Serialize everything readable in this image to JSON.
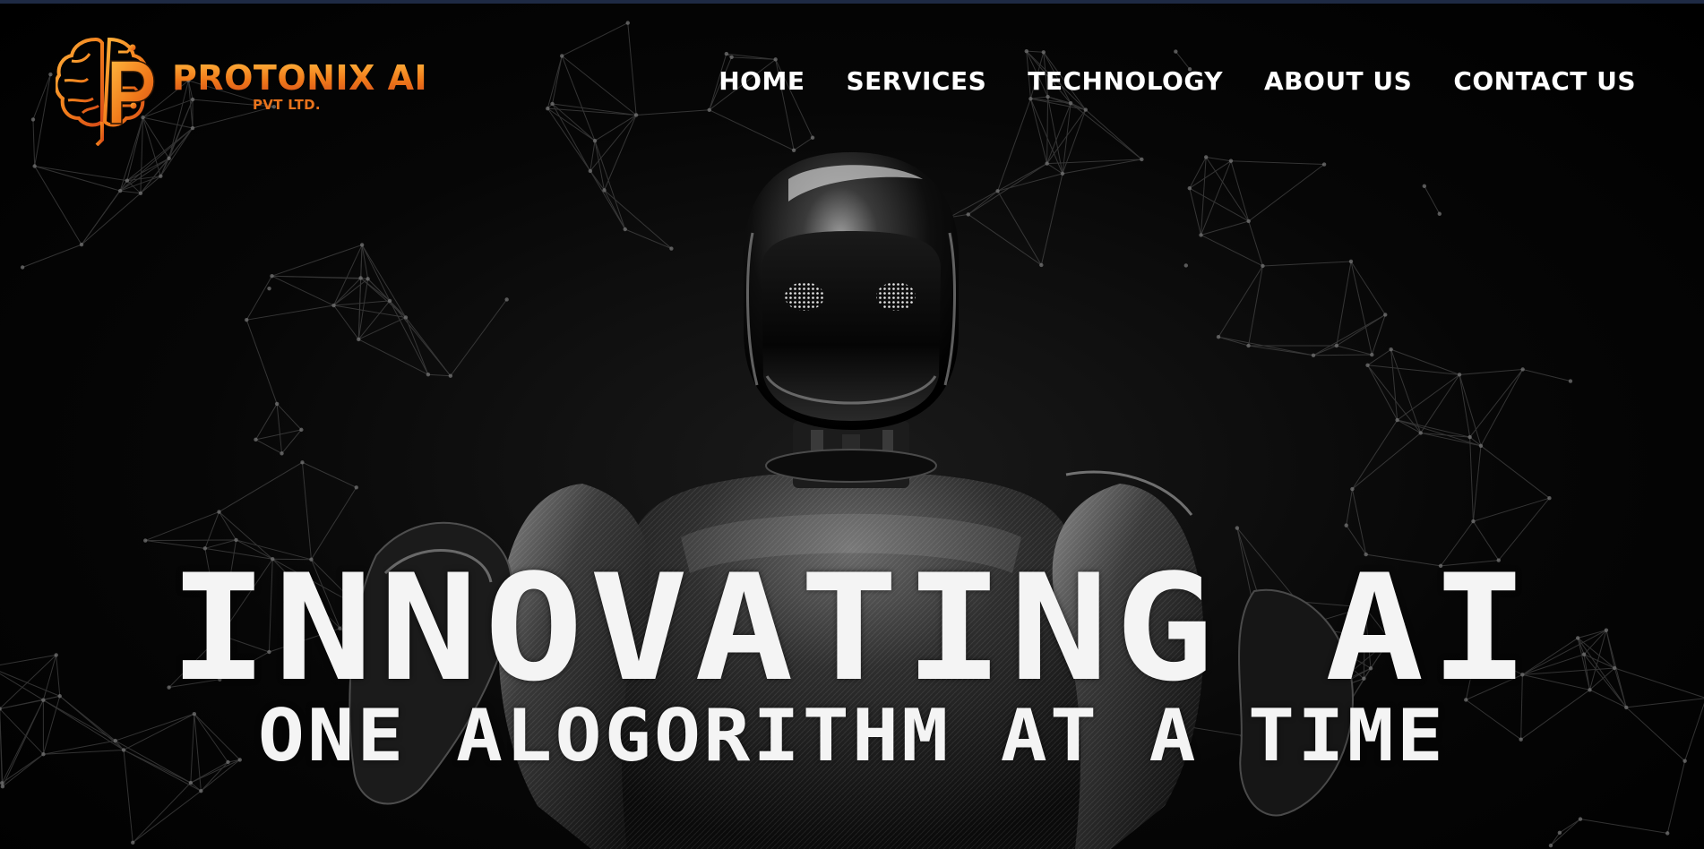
{
  "brand": {
    "name": "PROTONIX AI",
    "sub": "PVT LTD.",
    "accent_color": "#f28a1d",
    "logo_icon": "brain-circuit-p-icon"
  },
  "nav": {
    "items": [
      {
        "label": "HOME"
      },
      {
        "label": "SERVICES"
      },
      {
        "label": "TECHNOLOGY"
      },
      {
        "label": "ABOUT US"
      },
      {
        "label": "CONTACT US"
      }
    ]
  },
  "hero": {
    "title": "INNOVATING AI",
    "subtitle": "ONE ALOGORITHM AT A TIME",
    "image": "humanoid-robot-image",
    "background": "network-mesh-background"
  },
  "colors": {
    "background": "#000000",
    "nav_text": "#ffffff",
    "hero_text": "#f4f4f4"
  }
}
